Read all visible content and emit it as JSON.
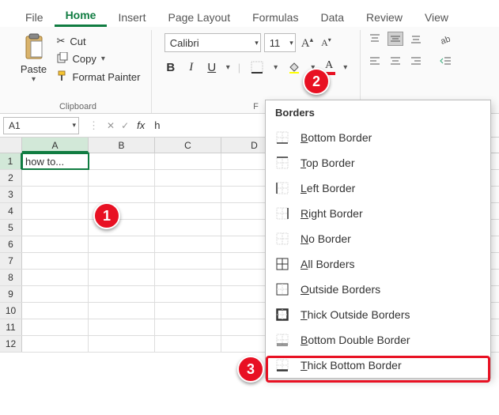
{
  "tabs": [
    "File",
    "Home",
    "Insert",
    "Page Layout",
    "Formulas",
    "Data",
    "Review",
    "View"
  ],
  "active_tab": "Home",
  "clipboard": {
    "paste": "Paste",
    "cut": "Cut",
    "copy": "Copy",
    "format_painter": "Format Painter",
    "group_label": "Clipboard"
  },
  "font": {
    "name": "Calibri",
    "size": "11",
    "group_label": "F"
  },
  "namebox": "A1",
  "formula_bar": "h",
  "cell_a1": "how to...",
  "columns": [
    "A",
    "B",
    "C",
    "D"
  ],
  "row_count": 12,
  "borders_menu": {
    "header": "Borders",
    "items": [
      {
        "key": "bottom",
        "label": "Bottom Border",
        "mnemonic": "B"
      },
      {
        "key": "top",
        "label": "Top Border",
        "mnemonic": "T"
      },
      {
        "key": "left",
        "label": "Left Border",
        "mnemonic": "L"
      },
      {
        "key": "right",
        "label": "Right Border",
        "mnemonic": "R"
      },
      {
        "key": "none",
        "label": "No Border",
        "mnemonic": "N"
      },
      {
        "key": "all",
        "label": "All Borders",
        "mnemonic": "A"
      },
      {
        "key": "outside",
        "label": "Outside Borders",
        "mnemonic": "O"
      },
      {
        "key": "thick-outside",
        "label": "Thick Outside Borders",
        "mnemonic": "T"
      },
      {
        "key": "bottom-double",
        "label": "Bottom Double Border",
        "mnemonic": "B"
      },
      {
        "key": "thick-bottom",
        "label": "Thick Bottom Border",
        "mnemonic": "T"
      }
    ]
  },
  "callouts": {
    "c1": "1",
    "c2": "2",
    "c3": "3"
  }
}
